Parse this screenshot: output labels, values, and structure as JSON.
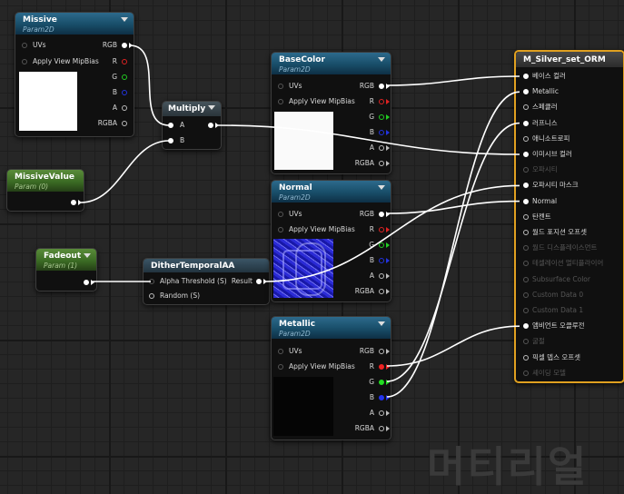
{
  "watermark": "머티리얼",
  "nodes": {
    "missive": {
      "title": "Missive",
      "subtitle": "Param2D",
      "inputs": [
        "UVs",
        "Apply View MipBias"
      ],
      "outputs": [
        "RGB",
        "R",
        "G",
        "B",
        "A",
        "RGBA"
      ]
    },
    "multiply": {
      "title": "Multiply",
      "inputs": [
        "A",
        "B"
      ]
    },
    "missive_value": {
      "title": "MissiveValue",
      "subtitle": "Param (0)"
    },
    "fadeout": {
      "title": "Fadeout",
      "subtitle": "Param (1)"
    },
    "dither": {
      "title": "DitherTemporalAA",
      "inputs": [
        "Alpha Threshold (S)",
        "Random (S)"
      ],
      "output": "Result"
    },
    "basecolor": {
      "title": "BaseColor",
      "subtitle": "Param2D",
      "inputs": [
        "UVs",
        "Apply View MipBias"
      ],
      "outputs": [
        "RGB",
        "R",
        "G",
        "B",
        "A",
        "RGBA"
      ]
    },
    "normal": {
      "title": "Normal",
      "subtitle": "Param2D",
      "inputs": [
        "UVs",
        "Apply View MipBias"
      ],
      "outputs": [
        "RGB",
        "R",
        "G",
        "B",
        "A",
        "RGBA"
      ]
    },
    "metallic": {
      "title": "Metallic",
      "subtitle": "Param2D",
      "inputs": [
        "UVs",
        "Apply View MipBias"
      ],
      "outputs": [
        "RGB",
        "R",
        "G",
        "B",
        "A",
        "RGBA"
      ]
    },
    "material": {
      "title": "M_Silver_set_ORM",
      "inputs": [
        {
          "label": "베이스 컬러",
          "enabled": true,
          "connected": true
        },
        {
          "label": "Metallic",
          "enabled": true,
          "connected": true
        },
        {
          "label": "스페큘러",
          "enabled": true,
          "connected": false
        },
        {
          "label": "러프니스",
          "enabled": true,
          "connected": true
        },
        {
          "label": "애니소트로피",
          "enabled": true,
          "connected": false
        },
        {
          "label": "이미시브 컬러",
          "enabled": true,
          "connected": true
        },
        {
          "label": "오파시티",
          "enabled": false,
          "connected": false
        },
        {
          "label": "오파시티 마스크",
          "enabled": true,
          "connected": true
        },
        {
          "label": "Normal",
          "enabled": true,
          "connected": true
        },
        {
          "label": "탄젠트",
          "enabled": true,
          "connected": false
        },
        {
          "label": "월드 포지션 오프셋",
          "enabled": true,
          "connected": false
        },
        {
          "label": "월드 디스플레이스먼트",
          "enabled": false,
          "connected": false
        },
        {
          "label": "테셀레이션 멀티플라이어",
          "enabled": false,
          "connected": false
        },
        {
          "label": "Subsurface Color",
          "enabled": false,
          "connected": false
        },
        {
          "label": "Custom Data 0",
          "enabled": false,
          "connected": false
        },
        {
          "label": "Custom Data 1",
          "enabled": false,
          "connected": false
        },
        {
          "label": "앰비언트 오클루전",
          "enabled": true,
          "connected": true
        },
        {
          "label": "굴절",
          "enabled": false,
          "connected": false
        },
        {
          "label": "픽셀 뎁스 오프셋",
          "enabled": true,
          "connected": false
        },
        {
          "label": "셰이딩 모델",
          "enabled": false,
          "connected": false
        }
      ]
    }
  },
  "colors": {
    "param_header": "#184d68",
    "scalar_header": "#3b6b24",
    "selected_border": "#e0a020",
    "wire": "#ffffff"
  }
}
